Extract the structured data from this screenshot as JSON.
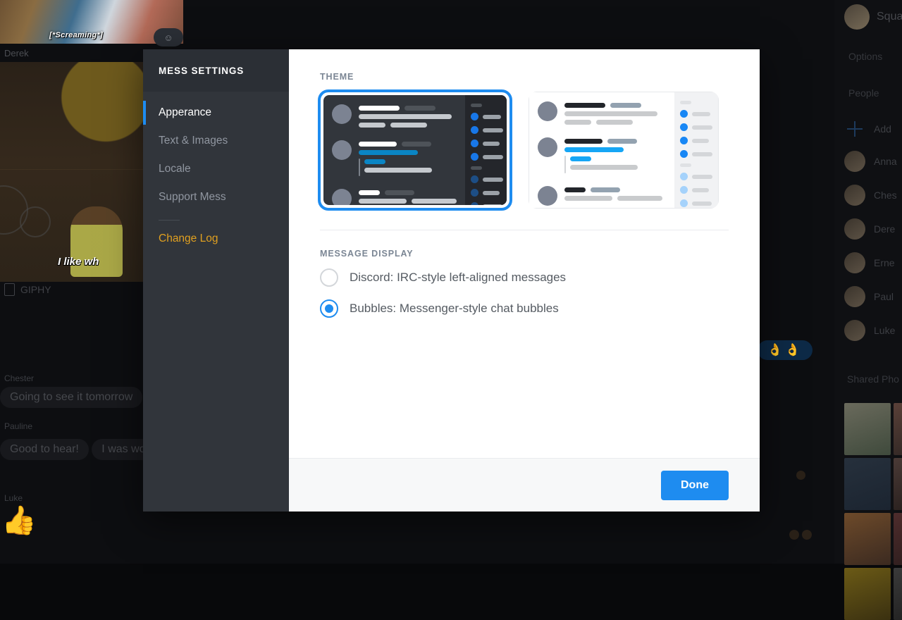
{
  "background": {
    "gif_banner_caption": "[*Screaming*]",
    "reaction_chip": "☺",
    "top_sender": "Derek",
    "gif_caption": "I like wh",
    "giphy_label": "GIPHY",
    "emoji_bubble": "👌👌",
    "messages": [
      {
        "author": "Chester",
        "text": "Going to see it tomorrow"
      },
      {
        "author": "Pauline",
        "text": "Good to hear!"
      },
      {
        "author": "",
        "text": "I was worried it wouldn't live"
      },
      {
        "author": "Luke",
        "text": "👍"
      }
    ],
    "people_panel": {
      "title": "Squad",
      "options_label": "Options",
      "people_label": "People",
      "add_label": "Add",
      "shared_photos_label": "Shared Pho",
      "members": [
        "Anna",
        "Ches",
        "Dere",
        "Erne",
        "Paul",
        "Luke"
      ]
    }
  },
  "modal": {
    "nav": {
      "title": "MESS SETTINGS",
      "items": [
        {
          "label": "Apperance",
          "state": "active"
        },
        {
          "label": "Text & Images",
          "state": "normal"
        },
        {
          "label": "Locale",
          "state": "normal"
        },
        {
          "label": "Support Mess",
          "state": "normal"
        }
      ],
      "link": {
        "label": "Change Log"
      }
    },
    "theme": {
      "section_label": "THEME",
      "options": [
        {
          "name": "dark",
          "selected": true
        },
        {
          "name": "light",
          "selected": false
        }
      ]
    },
    "message_display": {
      "section_label": "MESSAGE DISPLAY",
      "options": [
        {
          "label": "Discord: IRC-style left-aligned messages",
          "selected": false
        },
        {
          "label": "Bubbles: Messenger-style chat bubbles",
          "selected": true
        }
      ]
    },
    "footer": {
      "done_label": "Done"
    }
  },
  "colors": {
    "accent_blue": "#1e8cf0",
    "link_amber": "#e0a020",
    "nav_bg": "#31353b",
    "nav_head_bg": "#2b2f35",
    "footer_bg": "#f7f8f9",
    "dark_theme_bg": "#32363c",
    "light_theme_bg": "#ffffff"
  }
}
